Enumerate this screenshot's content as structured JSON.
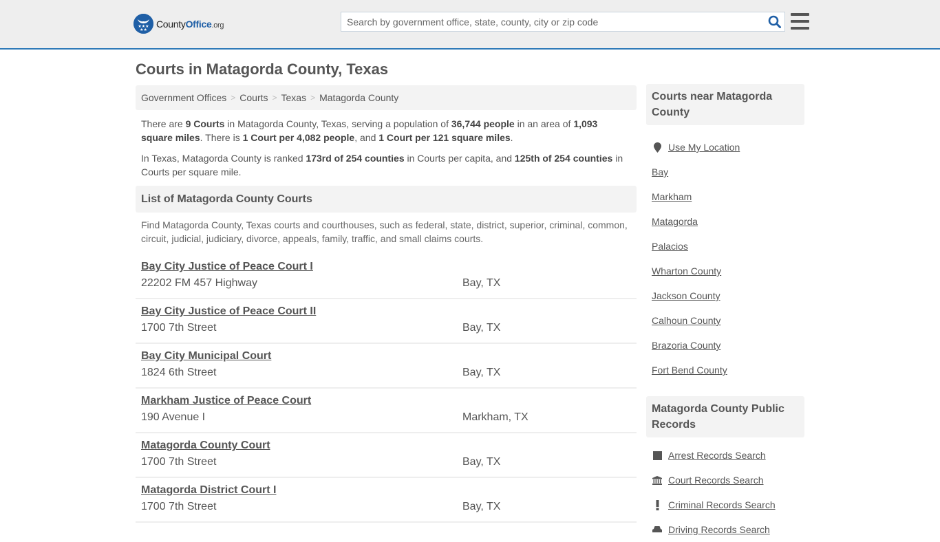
{
  "header": {
    "logo": {
      "name_part1": "County",
      "name_part2": "Office",
      "tld": ".org"
    },
    "search": {
      "placeholder": "Search by government office, state, county, city or zip code",
      "value": ""
    },
    "icons": {
      "search": "search-icon",
      "menu": "hamburger-menu-icon"
    },
    "accent_color": "#2f7ab8",
    "brand_color": "#1f5fa6"
  },
  "page": {
    "title": "Courts in Matagorda County, Texas"
  },
  "breadcrumb": [
    {
      "label": "Government Offices"
    },
    {
      "label": "Courts"
    },
    {
      "label": "Texas"
    },
    {
      "label": "Matagorda County"
    }
  ],
  "intro": {
    "p1": {
      "t1": "There are ",
      "b1": "9 Courts",
      "t2": " in Matagorda County, Texas, serving a population of ",
      "b2": "36,744 people",
      "t3": " in an area of ",
      "b3": "1,093 square miles",
      "t4": ". There is ",
      "b4": "1 Court per 4,082 people",
      "t5": ", and ",
      "b5": "1 Court per 121 square miles",
      "t6": "."
    },
    "p2": {
      "t1": "In Texas, Matagorda County is ranked ",
      "b1": "173rd of 254 counties",
      "t2": " in Courts per capita, and ",
      "b2": "125th of 254 counties",
      "t3": " in Courts per square mile."
    }
  },
  "list_section": {
    "heading": "List of Matagorda County Courts",
    "description": "Find Matagorda County, Texas courts and courthouses, such as federal, state, district, superior, criminal, common, circuit, judicial, judiciary, divorce, appeals, family, traffic, and small claims courts."
  },
  "courts": [
    {
      "name": "Bay City Justice of Peace Court I",
      "address": "22202 FM 457 Highway",
      "city": "Bay, TX"
    },
    {
      "name": "Bay City Justice of Peace Court II",
      "address": "1700 7th Street",
      "city": "Bay, TX"
    },
    {
      "name": "Bay City Municipal Court",
      "address": "1824 6th Street",
      "city": "Bay, TX"
    },
    {
      "name": "Markham Justice of Peace Court",
      "address": "190 Avenue I",
      "city": "Markham, TX"
    },
    {
      "name": "Matagorda County Court",
      "address": "1700 7th Street",
      "city": "Bay, TX"
    },
    {
      "name": "Matagorda District Court I",
      "address": "1700 7th Street",
      "city": "Bay, TX"
    }
  ],
  "sidebar": {
    "near": {
      "heading": "Courts near Matagorda County",
      "use_location": {
        "label": "Use My Location",
        "icon": "map-marker-icon"
      },
      "items": [
        "Bay",
        "Markham",
        "Matagorda",
        "Palacios",
        "Wharton County",
        "Jackson County",
        "Calhoun County",
        "Brazoria County",
        "Fort Bend County"
      ]
    },
    "records": {
      "heading": "Matagorda County Public Records",
      "items": [
        {
          "label": "Arrest Records Search",
          "icon": "square-icon"
        },
        {
          "label": "Court Records Search",
          "icon": "courthouse-icon"
        },
        {
          "label": "Criminal Records Search",
          "icon": "exclamation-icon"
        },
        {
          "label": "Driving Records Search",
          "icon": "car-icon"
        }
      ]
    }
  }
}
